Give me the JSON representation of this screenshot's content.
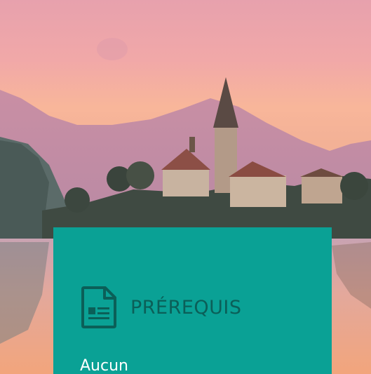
{
  "card": {
    "title": "PRÉREQUIS",
    "value": "Aucun",
    "icon": "document-icon",
    "background_color": "#0aa195",
    "title_color": "#0b5f58"
  },
  "hero": {
    "image_subject": "landscape-photo"
  }
}
